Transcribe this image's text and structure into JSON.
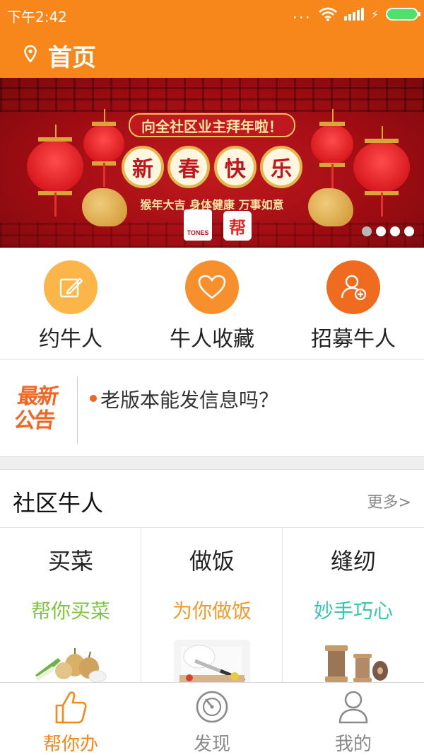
{
  "status_bar": {
    "time": "下午2:42",
    "dots": "..."
  },
  "header": {
    "title": "首页",
    "location_icon": "location-pin-icon"
  },
  "banner": {
    "slogan": "向全社区业主拜年啦！",
    "blessings": [
      "新",
      "春",
      "快",
      "乐"
    ],
    "subline": "猴年大吉 身体健康 万事如意",
    "logo_text": "TONES",
    "seal_text": "帮",
    "slide_count": 4,
    "active_slide": 1
  },
  "shortcuts": [
    {
      "label": "约牛人",
      "icon": "edit-note-icon",
      "color": "#fbb548"
    },
    {
      "label": "牛人收藏",
      "icon": "heart-icon",
      "color": "#f7902c"
    },
    {
      "label": "招募牛人",
      "icon": "add-user-icon",
      "color": "#ef6b1f"
    }
  ],
  "notice": {
    "badge_line1": "最新",
    "badge_line2": "公告",
    "text": "老版本能发信息吗？"
  },
  "community": {
    "title": "社区牛人",
    "more": "更多>",
    "cards": [
      {
        "title": "买菜",
        "subtitle": "帮你买菜",
        "color": "#80c540",
        "image": "vegetables-image"
      },
      {
        "title": "做饭",
        "subtitle": "为你做饭",
        "color": "#f39a2d",
        "image": "cooking-image"
      },
      {
        "title": "缝纫",
        "subtitle": "妙手巧心",
        "color": "#36c7ae",
        "image": "sewing-thread-image"
      }
    ]
  },
  "tabbar": {
    "tabs": [
      {
        "label": "帮你办",
        "icon": "thumbs-up-icon",
        "active": true
      },
      {
        "label": "发现",
        "icon": "compass-icon",
        "active": false
      },
      {
        "label": "我的",
        "icon": "profile-icon",
        "active": false
      }
    ],
    "active_color": "#f7871b",
    "inactive_color": "#8a8a8a"
  }
}
